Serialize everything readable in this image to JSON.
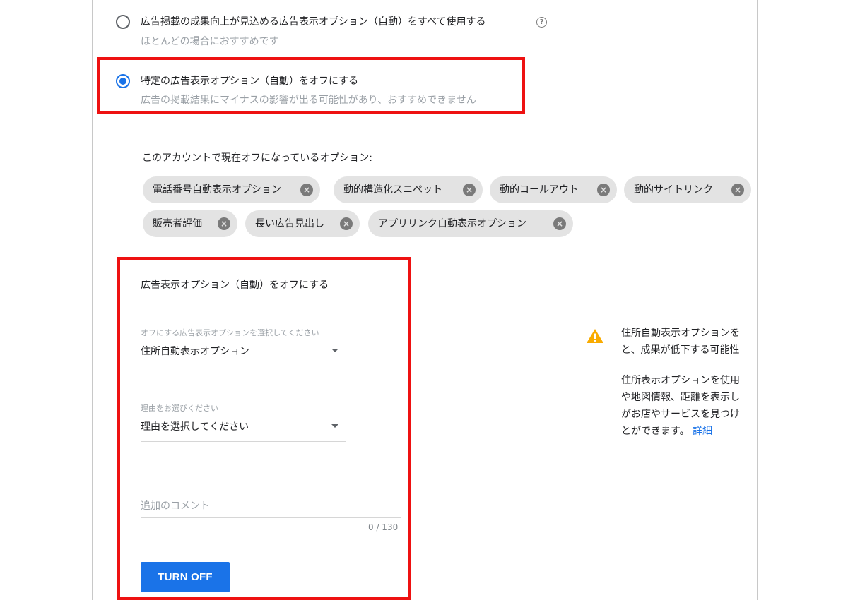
{
  "options": [
    {
      "label": "広告掲載の成果向上が見込める広告表示オプション（自動）をすべて使用する",
      "desc": "ほとんどの場合におすすめです",
      "checked": false
    },
    {
      "label": "特定の広告表示オプション（自動）をオフにする",
      "desc": "広告の掲載結果にマイナスの影響が出る可能性があり、おすすめできません",
      "checked": true
    }
  ],
  "help_icon": "?",
  "off_section": {
    "title": "このアカウントで現在オフになっているオプション:",
    "chips": [
      "電話番号自動表示オプション",
      "動的構造化スニペット",
      "動的コールアウト",
      "動的サイトリンク",
      "販売者評価",
      "長い広告見出し",
      "アプリリンク自動表示オプション"
    ],
    "chip_remove_glyph": "×"
  },
  "form": {
    "title": "広告表示オプション（自動）をオフにする",
    "option_select": {
      "label": "オフにする広告表示オプションを選択してください",
      "value": "住所自動表示オプション"
    },
    "reason_select": {
      "label": "理由をお選びください",
      "value": "理由を選択してください"
    },
    "comment": {
      "placeholder": "追加のコメント",
      "counter": "0 / 130"
    },
    "submit_label": "TURN OFF"
  },
  "warning": {
    "icon": "warning-icon",
    "line1": "住所自動表示オプションを",
    "line2": "と、成果が低下する可能性",
    "para2_lines": [
      "住所表示オプションを使用",
      "や地図情報、距離を表示し",
      "がお店やサービスを見つけ"
    ],
    "last_line": "とができます。",
    "link": "詳細"
  },
  "colors": {
    "accent": "#1a73e8",
    "highlight": "#ee1111",
    "warning": "#f9ab00"
  }
}
